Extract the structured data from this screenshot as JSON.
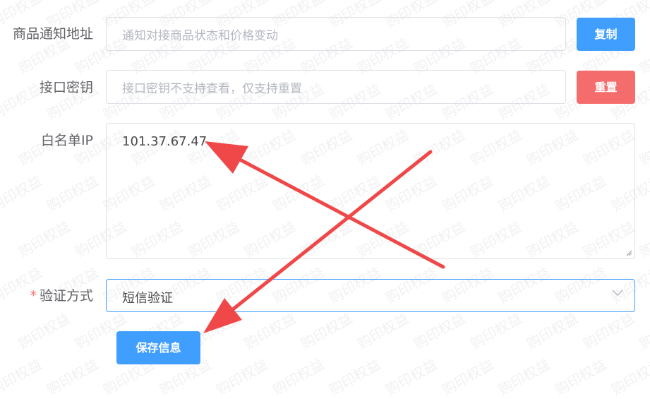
{
  "watermark": {
    "text": "购印权益"
  },
  "form": {
    "notify_url": {
      "label": "商品通知地址",
      "placeholder": "通知对接商品状态和价格变动",
      "button_label": "复制"
    },
    "api_secret": {
      "label": "接口密钥",
      "placeholder": "接口密钥不支持查看，仅支持重置",
      "button_label": "重置"
    },
    "whitelist_ip": {
      "label": "白名单IP",
      "value": "101.37.67.47"
    },
    "verify_method": {
      "required_mark": "*",
      "label": "验证方式",
      "selected": "短信验证"
    },
    "save_button_label": "保存信息"
  },
  "colors": {
    "primary": "#409eff",
    "danger": "#f56c6c",
    "annotation": "#f04848"
  },
  "icons": [
    "chevron-down-icon",
    "resize-handle-icon",
    "annotation-arrow",
    "annotation-cross"
  ]
}
